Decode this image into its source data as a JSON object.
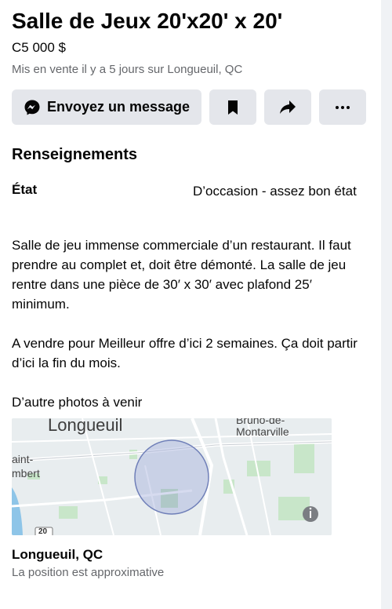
{
  "listing": {
    "title": "Salle de Jeux 20'x20' x 20'",
    "price": "C5 000 $",
    "listed_meta": "Mis en vente il y a 5 jours sur Longueuil, QC"
  },
  "actions": {
    "message_label": "Envoyez un message",
    "icons": [
      "messenger-icon",
      "bookmark-icon",
      "share-icon",
      "more-icon"
    ]
  },
  "details": {
    "section_title": "Renseignements",
    "condition_label": "État",
    "condition_value": "D’occasion - assez bon état"
  },
  "description": "Salle de jeu immense commerciale d’un restaurant. Il faut prendre au complet et, doit être démonté.   La salle de jeu rentre dans une pièce de 30′ x 30′ avec plafond 25′ minimum.\n\nA vendre pour Meilleur offre d’ici 2 semaines. Ça doit partir d’ici la fin du mois.\n\nD’autre photos à venir",
  "map": {
    "labels": {
      "longueuil": "Longueuil",
      "bruno": "Bruno-de-",
      "montarville": "Montarville",
      "saint": "aint-",
      "lambert": "mbert",
      "route": "20"
    }
  },
  "location": {
    "title": "Longueuil, QC",
    "subtitle": "La position est approximative"
  },
  "colors": {
    "button_bg": "#e4e6eb",
    "secondary_text": "#65676b",
    "map_water": "#8ec5e8",
    "map_green": "#c8e6c9",
    "radius_fill": "#a3b0dc"
  }
}
